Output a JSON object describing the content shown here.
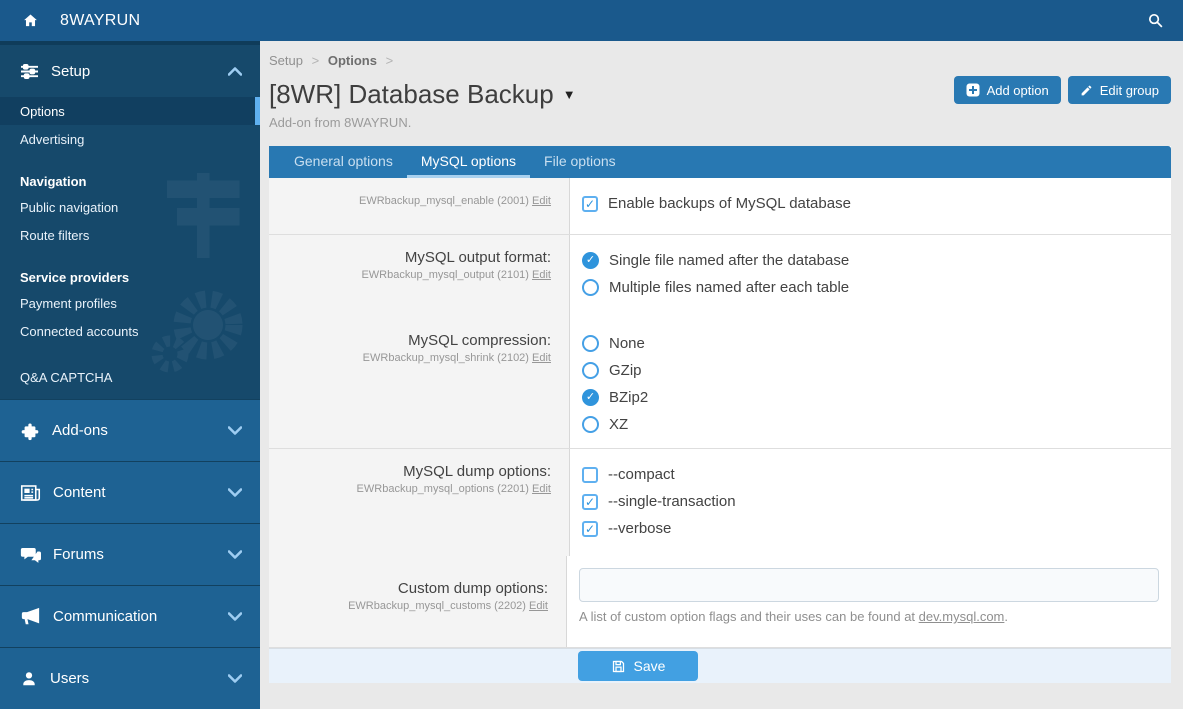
{
  "topbar": {
    "title": "8WAYRUN"
  },
  "breadcrumb": {
    "items": [
      "Setup",
      "Options"
    ],
    "separator": ">"
  },
  "page": {
    "title": "[8WR] Database Backup",
    "subtitle": "Add-on from 8WAYRUN.",
    "add_option_label": "Add option",
    "edit_group_label": "Edit group"
  },
  "tabs": [
    {
      "label": "General options",
      "active": false
    },
    {
      "label": "MySQL options",
      "active": true
    },
    {
      "label": "File options",
      "active": false
    }
  ],
  "sidebar": {
    "setup": {
      "label": "Setup",
      "groups": [
        {
          "heading": null,
          "items": [
            {
              "label": "Options",
              "active": true
            },
            {
              "label": "Advertising",
              "active": false
            }
          ]
        },
        {
          "heading": "Navigation",
          "items": [
            {
              "label": "Public navigation",
              "active": false
            },
            {
              "label": "Route filters",
              "active": false
            }
          ]
        },
        {
          "heading": "Service providers",
          "items": [
            {
              "label": "Payment profiles",
              "active": false
            },
            {
              "label": "Connected accounts",
              "active": false
            }
          ]
        },
        {
          "heading": null,
          "items": [
            {
              "label": "Q&A CAPTCHA",
              "active": false
            }
          ]
        }
      ]
    },
    "sections": [
      {
        "label": "Add-ons",
        "icon": "puzzle-icon"
      },
      {
        "label": "Content",
        "icon": "newspaper-icon"
      },
      {
        "label": "Forums",
        "icon": "chat-icon"
      },
      {
        "label": "Communication",
        "icon": "megaphone-icon"
      },
      {
        "label": "Users",
        "icon": "user-icon"
      }
    ]
  },
  "form": {
    "rows": [
      {
        "label": "",
        "code": "EWRbackup_mysql_enable (2001)",
        "edit_label": "Edit",
        "type": "checkbox",
        "divider_below": true,
        "options": [
          {
            "label": "Enable backups of MySQL database",
            "checked": true
          }
        ]
      },
      {
        "label": "MySQL output format:",
        "code": "EWRbackup_mysql_output (2101)",
        "edit_label": "Edit",
        "type": "radio",
        "divider_below": false,
        "options": [
          {
            "label": "Single file named after the database",
            "checked": true
          },
          {
            "label": "Multiple files named after each table",
            "checked": false
          }
        ]
      },
      {
        "label": "MySQL compression:",
        "code": "EWRbackup_mysql_shrink (2102)",
        "edit_label": "Edit",
        "type": "radio",
        "divider_below": true,
        "options": [
          {
            "label": "None",
            "checked": false
          },
          {
            "label": "GZip",
            "checked": false
          },
          {
            "label": "BZip2",
            "checked": true
          },
          {
            "label": "XZ",
            "checked": false
          }
        ]
      },
      {
        "label": "MySQL dump options:",
        "code": "EWRbackup_mysql_options (2201)",
        "edit_label": "Edit",
        "type": "checkbox",
        "divider_below": false,
        "options": [
          {
            "label": "--compact",
            "checked": false
          },
          {
            "label": "--single-transaction",
            "checked": true
          },
          {
            "label": "--verbose",
            "checked": true
          }
        ]
      },
      {
        "label": "Custom dump options:",
        "code": "EWRbackup_mysql_customs (2202)",
        "edit_label": "Edit",
        "type": "text",
        "divider_below": true,
        "value": "",
        "help": {
          "before": "A list of custom option flags and their uses can be found at ",
          "link": "dev.mysql.com",
          "after": "."
        }
      }
    ],
    "save_label": "Save"
  },
  "colors": {
    "topbar": "#1a598c",
    "sidebar_dark": "#16496b",
    "sidebar_section": "#1e6293",
    "accent": "#2878b2",
    "active_marker": "#5fb0f0",
    "save_button": "#42a0e2",
    "footer_bg": "#e9f2fb"
  }
}
